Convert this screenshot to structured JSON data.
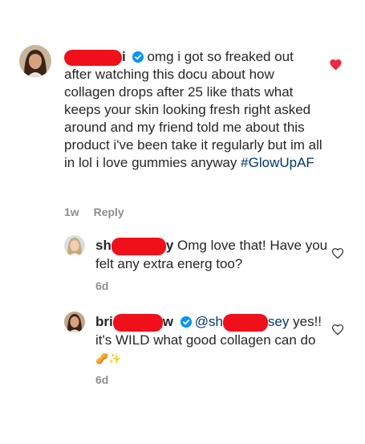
{
  "comments": [
    {
      "username_visible": "i",
      "verified": true,
      "text": "omg i got so freaked out after watching this docu about how collagen drops after 25 like thats what keeps your skin looking fresh right asked around and my friend told me about this product i've been take it regularly but im all in lol i love gummies anyway",
      "hashtag": "#GlowUpAF",
      "age": "1w",
      "reply_label": "Reply",
      "liked": true
    },
    {
      "username_visible_start": "sh",
      "username_visible_end": "y",
      "text": "Omg love that! Have you felt any extra energ too?",
      "age": "6d"
    },
    {
      "username_visible_start": "bri",
      "username_visible_end": "w",
      "verified": true,
      "mention_start": "@sh",
      "mention_end": "sey",
      "text_after_mention": "yes!! it's WILD what good collagen can do",
      "emoji": "🥜✨",
      "age": "6d"
    }
  ],
  "colors": {
    "redaction": "#f0101c",
    "liked_heart": "#ed2a3c",
    "verified_badge": "#0095f6",
    "meta_text": "#8e8e8e"
  },
  "icons": [
    "verified-badge-icon",
    "heart-filled-icon",
    "heart-outline-icon"
  ]
}
